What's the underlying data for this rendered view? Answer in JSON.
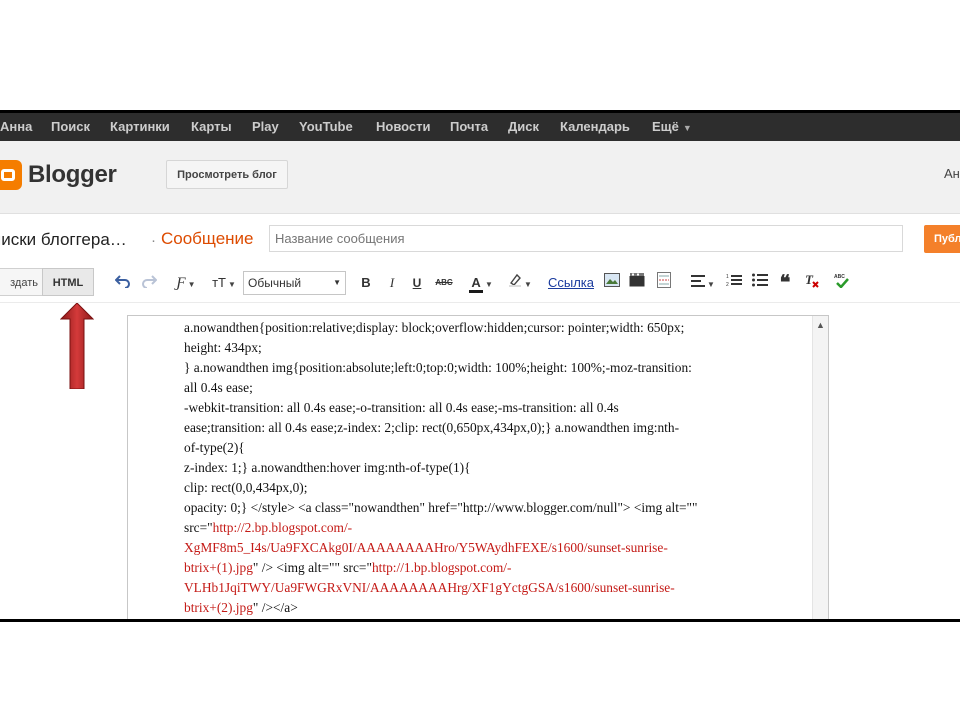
{
  "gbar": {
    "items": [
      "Анна",
      "Поиск",
      "Картинки",
      "Карты",
      "Play",
      "YouTube",
      "Новости",
      "Почта",
      "Диск",
      "Календарь",
      "Ещё"
    ]
  },
  "header": {
    "logo": "Blogger",
    "view_blog": "Просмотреть блог",
    "user": "Ан"
  },
  "post": {
    "blog_name": "писки блоггера…",
    "separator": "·",
    "label": "Сообщение",
    "title_placeholder": "Название сообщения",
    "publish": "Публ"
  },
  "toolbar": {
    "compose": "здать",
    "html": "HTML",
    "format": "Обычный",
    "link": "Ссылка"
  },
  "colors": {
    "accent_orange": "#f57d00",
    "publish_orange": "#f4802a",
    "gbar_bg": "#2d2d2d",
    "code_red": "#c41a16",
    "arrow_red": "#b22222"
  },
  "editor": {
    "lines": [
      {
        "parts": [
          {
            "t": "a.nowandthen{position:relative;display: block;overflow:hidden;cursor: pointer;width: 650px;",
            "c": "k"
          }
        ]
      },
      {
        "parts": [
          {
            "t": "height: 434px;",
            "c": "k"
          }
        ]
      },
      {
        "parts": [
          {
            "t": "}  a.nowandthen img{position:absolute;left:0;top:0;width: 100%;height: 100%;-moz-transition:",
            "c": "k"
          }
        ]
      },
      {
        "parts": [
          {
            "t": "all 0.4s ease;",
            "c": "k"
          }
        ]
      },
      {
        "parts": [
          {
            "t": "-webkit-transition: all 0.4s ease;-o-transition: all 0.4s ease;-ms-transition: all 0.4s",
            "c": "k"
          }
        ]
      },
      {
        "parts": [
          {
            "t": "ease;transition: all 0.4s ease;z-index: 2;clip: rect(0,650px,434px,0);}   a.nowandthen img:nth-",
            "c": "k"
          }
        ]
      },
      {
        "parts": [
          {
            "t": "of-type(2){",
            "c": "k"
          }
        ]
      },
      {
        "parts": [
          {
            "t": "z-index: 1;}   a.nowandthen:hover img:nth-of-type(1){",
            "c": "k"
          }
        ]
      },
      {
        "parts": [
          {
            "t": "clip: rect(0,0,434px,0);",
            "c": "k"
          }
        ]
      },
      {
        "parts": [
          {
            "t": "opacity: 0;} </style> <a class=\"nowandthen\" href=\"http://www.blogger.com/null\"> <img alt=\"\"",
            "c": "k"
          }
        ]
      },
      {
        "parts": [
          {
            "t": "src=\"",
            "c": "k"
          },
          {
            "t": "http://2.bp.blogspot.com/-",
            "c": "r"
          }
        ]
      },
      {
        "parts": [
          {
            "t": "XgMF8m5_I4s/Ua9FXCAkg0I/AAAAAAAAHro/Y5WAydhFEXE/s1600/sunset-sunrise-",
            "c": "r"
          }
        ]
      },
      {
        "parts": [
          {
            "t": "btrix+(1).jpg",
            "c": "r"
          },
          {
            "t": "\" /> <img alt=\"\" src=\"",
            "c": "k"
          },
          {
            "t": "http://1.bp.blogspot.com/-",
            "c": "r"
          }
        ]
      },
      {
        "parts": [
          {
            "t": "VLHb1JqiTWY/Ua9FWGRxVNI/AAAAAAAAHrg/XF1gYctgGSA/s1600/sunset-sunrise-",
            "c": "r"
          }
        ]
      },
      {
        "parts": [
          {
            "t": "btrix+(2).jpg",
            "c": "r"
          },
          {
            "t": "\" /></a>",
            "c": "k"
          }
        ]
      }
    ]
  }
}
